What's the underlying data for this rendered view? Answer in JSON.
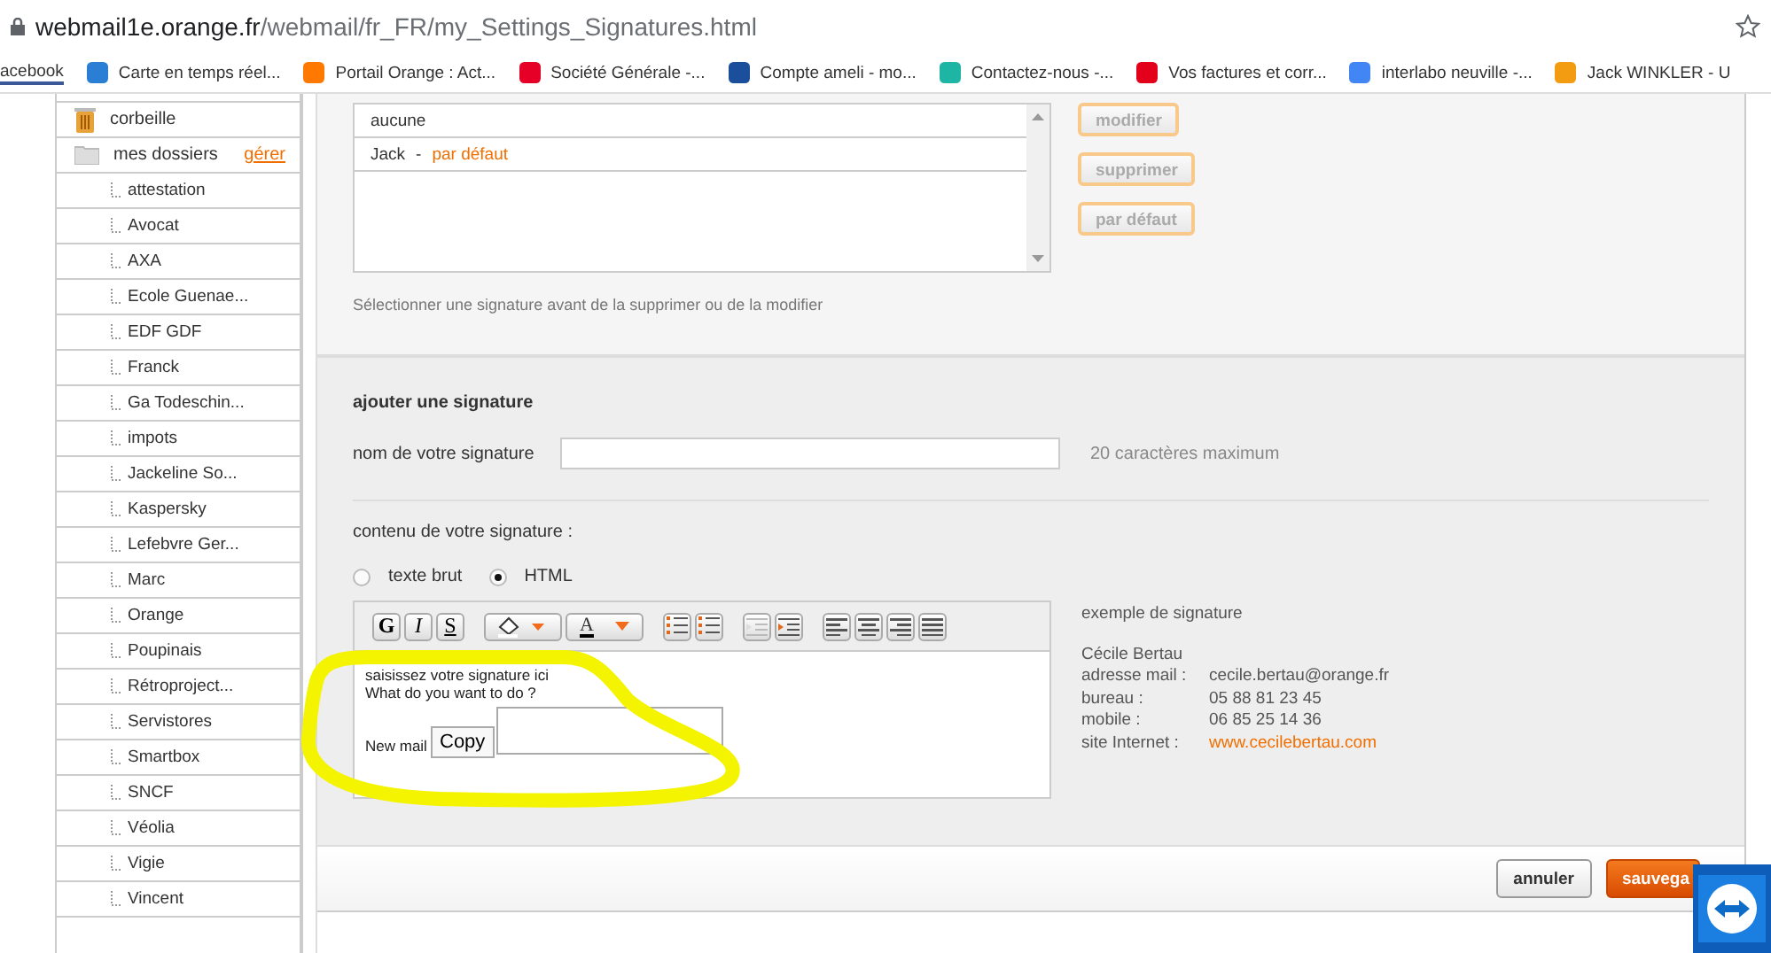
{
  "address_bar": {
    "host": "webmail1e.orange.fr",
    "path": "/webmail/fr_FR/my_Settings_Signatures.html"
  },
  "bookmarks": [
    {
      "label": "acebook",
      "color": "#3b5998"
    },
    {
      "label": "Carte en temps réel...",
      "color": "#2a7fd4"
    },
    {
      "label": "Portail Orange : Act...",
      "color": "#ff7900"
    },
    {
      "label": "Société Générale -...",
      "color": "#e60028"
    },
    {
      "label": "Compte ameli - mo...",
      "color": "#1b4f9c"
    },
    {
      "label": "Contactez-nous -...",
      "color": "#1fb5a5"
    },
    {
      "label": "Vos factures et corr...",
      "color": "#e2001a"
    },
    {
      "label": "interlabo neuville -...",
      "color": "#4285f4"
    },
    {
      "label": "Jack WINKLER - U",
      "color": "#f39c12"
    }
  ],
  "sidebar": {
    "items": [
      {
        "label": "corbeille",
        "kind": "trash"
      },
      {
        "label": "mes dossiers",
        "kind": "folder",
        "action": "gérer",
        "children": [
          {
            "label": "attestation"
          },
          {
            "label": "Avocat"
          },
          {
            "label": "AXA"
          },
          {
            "label": "Ecole Guenae..."
          },
          {
            "label": "EDF GDF"
          },
          {
            "label": "Franck"
          },
          {
            "label": "Ga Todeschin..."
          },
          {
            "label": "impots"
          },
          {
            "label": "Jackeline So..."
          },
          {
            "label": "Kaspersky"
          },
          {
            "label": "Lefebvre Ger..."
          },
          {
            "label": "Marc"
          },
          {
            "label": "Orange"
          },
          {
            "label": "Poupinais"
          },
          {
            "label": "Rétroproject..."
          },
          {
            "label": "Servistores"
          },
          {
            "label": "Smartbox"
          },
          {
            "label": "SNCF"
          },
          {
            "label": "Véolia"
          },
          {
            "label": "Vigie"
          },
          {
            "label": "Vincent"
          }
        ]
      }
    ]
  },
  "signatures": {
    "list": [
      {
        "name": "aucune"
      },
      {
        "name": "Jack",
        "separator": "-",
        "default_tag": "par défaut"
      }
    ],
    "actions": [
      {
        "label": "modifier",
        "disabled": true
      },
      {
        "label": "supprimer",
        "disabled": true
      },
      {
        "label": "par défaut",
        "disabled": true
      }
    ],
    "hint": "Sélectionner une signature avant de la supprimer ou de la modifier"
  },
  "add_signature": {
    "title": "ajouter une signature",
    "name_label": "nom de votre signature",
    "name_hint": "20 caractères maximum",
    "content_label": "contenu de votre signature :",
    "formats": [
      {
        "label": "texte brut",
        "selected": false
      },
      {
        "label": "HTML",
        "selected": true
      }
    ],
    "toolbar": [
      {
        "kind": "letter",
        "label": "G"
      },
      {
        "kind": "letter",
        "label": "I"
      },
      {
        "kind": "letter",
        "label": "S"
      },
      {
        "kind": "fill-color"
      },
      {
        "kind": "text-color",
        "label": "A"
      },
      {
        "kind": "ordered-list"
      },
      {
        "kind": "bullet-list"
      },
      {
        "kind": "outdent"
      },
      {
        "kind": "indent"
      },
      {
        "kind": "align-left"
      },
      {
        "kind": "align-center"
      },
      {
        "kind": "align-right"
      },
      {
        "kind": "justify"
      }
    ],
    "editor_lines": [
      "saisissez votre signature ici",
      "What do you want to do ?"
    ],
    "editor_new_mail": "New mail",
    "popup_button": "Copy",
    "example": {
      "title": "exemple de signature",
      "name": "Cécile Bertau",
      "rows": [
        {
          "label": "adresse mail :",
          "value": "cecile.bertau@orange.fr",
          "link": false
        },
        {
          "label": "bureau :",
          "value": "05 88 81 23 45",
          "link": false
        },
        {
          "label": "mobile :",
          "value": "06 85 25 14 36",
          "link": false
        },
        {
          "label": "site Internet :",
          "value": "www.cecilebertau.com",
          "link": true
        }
      ]
    }
  },
  "footer": {
    "buttons": [
      {
        "label": "annuler",
        "kind": "secondary"
      },
      {
        "label": "sauvega",
        "kind": "primary"
      }
    ]
  }
}
